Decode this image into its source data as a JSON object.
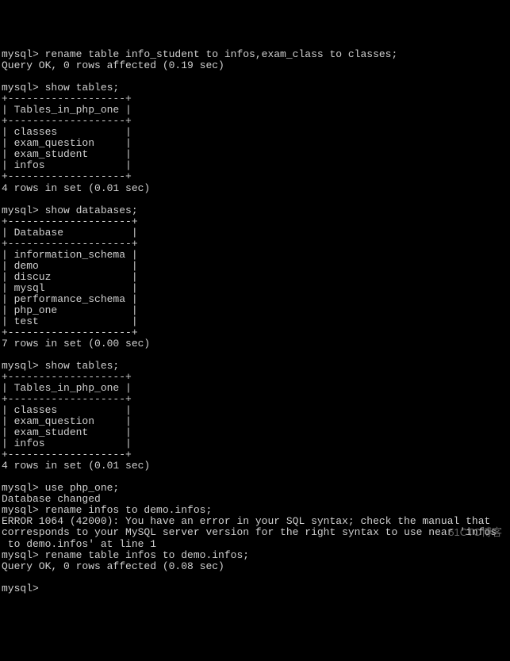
{
  "lines": [
    "mysql> rename table info_student to infos,exam_class to classes;",
    "Query OK, 0 rows affected (0.19 sec)",
    "",
    "mysql> show tables;",
    "+-------------------+",
    "| Tables_in_php_one |",
    "+-------------------+",
    "| classes           |",
    "| exam_question     |",
    "| exam_student      |",
    "| infos             |",
    "+-------------------+",
    "4 rows in set (0.01 sec)",
    "",
    "mysql> show databases;",
    "+--------------------+",
    "| Database           |",
    "+--------------------+",
    "| information_schema |",
    "| demo               |",
    "| discuz             |",
    "| mysql              |",
    "| performance_schema |",
    "| php_one            |",
    "| test               |",
    "+--------------------+",
    "7 rows in set (0.00 sec)",
    "",
    "mysql> show tables;",
    "+-------------------+",
    "| Tables_in_php_one |",
    "+-------------------+",
    "| classes           |",
    "| exam_question     |",
    "| exam_student      |",
    "| infos             |",
    "+-------------------+",
    "4 rows in set (0.01 sec)",
    "",
    "mysql> use php_one;",
    "Database changed",
    "mysql> rename infos to demo.infos;",
    "ERROR 1064 (42000): You have an error in your SQL syntax; check the manual that",
    "corresponds to your MySQL server version for the right syntax to use near 'infos",
    " to demo.infos' at line 1",
    "mysql> rename table infos to demo.infos;",
    "Query OK, 0 rows affected (0.08 sec)",
    "",
    "mysql>"
  ],
  "watermark": "51CTO博客"
}
